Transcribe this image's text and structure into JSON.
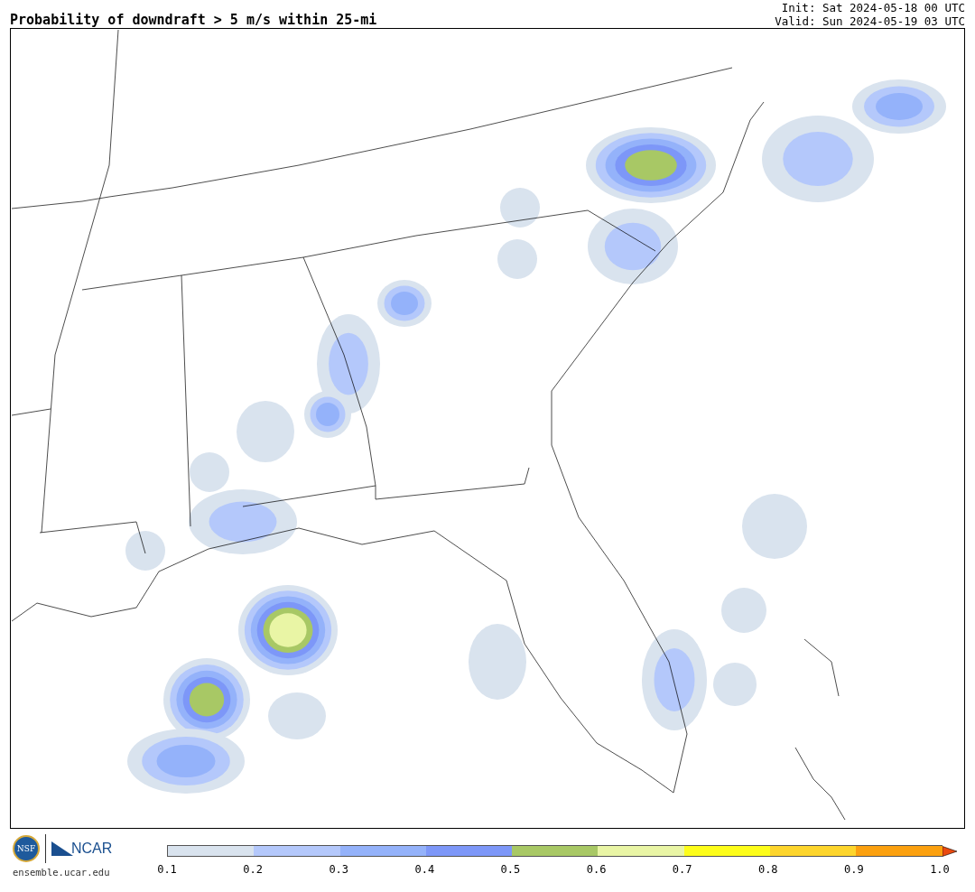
{
  "title": "Probability of downdraft > 5 m/s within 25-mi",
  "init": "Init: Sat 2024-05-18 00 UTC",
  "valid": "Valid: Sun 2024-05-19 03 UTC",
  "logos": {
    "nsf": "NSF",
    "ncar": "NCAR",
    "url": "ensemble.ucar.edu"
  },
  "colorbar": {
    "bins": [
      {
        "color": "#d9e3ee"
      },
      {
        "color": "#b4c8fb"
      },
      {
        "color": "#94b2fa"
      },
      {
        "color": "#7d97f8"
      },
      {
        "color": "#a8c865"
      },
      {
        "color": "#e9f5a5"
      },
      {
        "color": "#fdfd1a"
      },
      {
        "color": "#fdd52c"
      },
      {
        "color": "#fba00f"
      },
      {
        "kind": "extension",
        "color": "#ea4a10"
      }
    ],
    "ticks": [
      "0.1",
      "0.2",
      "0.3",
      "0.4",
      "0.5",
      "0.6",
      "0.7",
      "0.8",
      "0.9",
      "1.0"
    ]
  }
}
